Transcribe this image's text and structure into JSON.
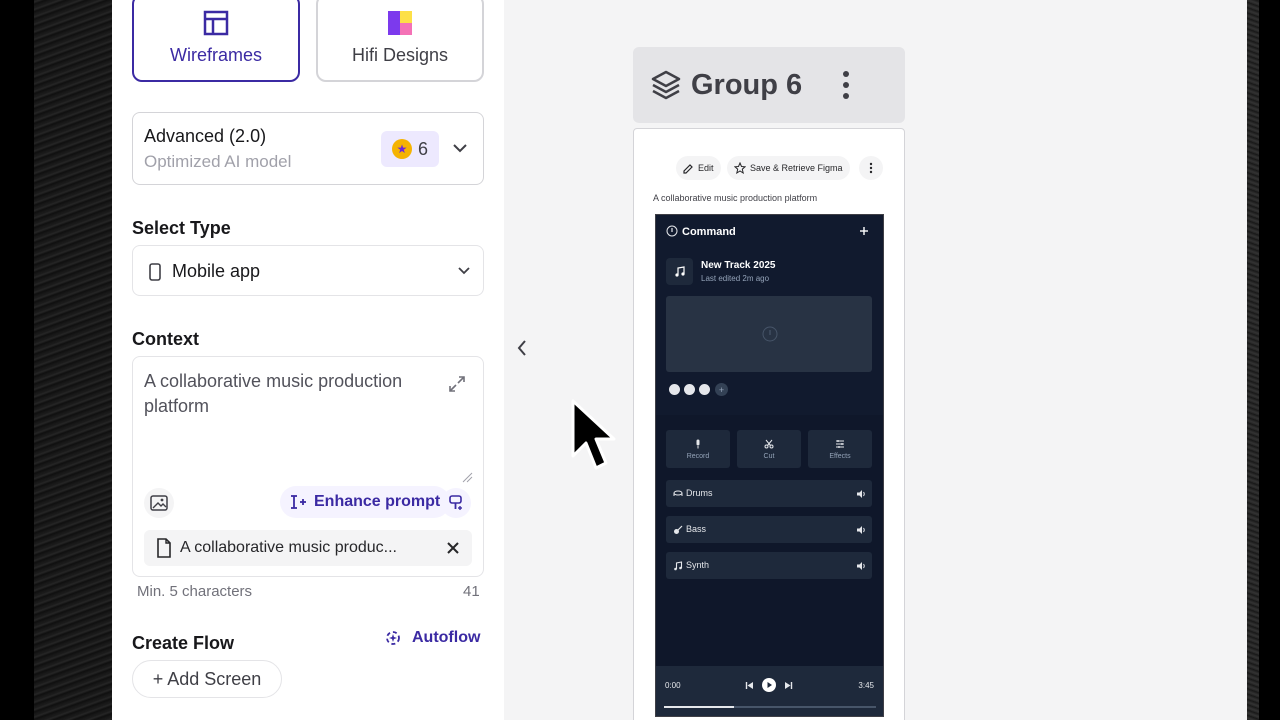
{
  "modes": [
    {
      "label": "Wireframes",
      "active": true,
      "icon": "layout-icon"
    },
    {
      "label": "Hifi Designs",
      "active": false,
      "icon": "palette-icon"
    }
  ],
  "model": {
    "title": "Advanced (2.0)",
    "subtitle": "Optimized AI model",
    "credits": "6"
  },
  "select_type": {
    "label": "Select Type",
    "value": "Mobile app"
  },
  "context": {
    "label": "Context",
    "text": "A collaborative music production platform",
    "enhance_label": "Enhance prompt",
    "attachment_name": "A collaborative music produc...",
    "min_hint": "Min. 5 characters",
    "char_count": "41"
  },
  "create_flow": {
    "label": "Create Flow",
    "autoflow_label": "Autoflow",
    "add_screen_label": "+ Add Screen"
  },
  "canvas": {
    "group_title": "Group 6",
    "toolbar": {
      "edit_label": "Edit",
      "save_label": "Save & Retrieve Figma"
    },
    "frame_description": "A collaborative music production platform",
    "phone": {
      "title": "Command",
      "track_name": "New Track 2025",
      "track_meta": "Last edited 2m ago",
      "tools": [
        "Record",
        "Cut",
        "Effects"
      ],
      "instruments": [
        "Drums",
        "Bass",
        "Synth"
      ],
      "time_start": "0:00",
      "time_end": "3:45",
      "progress": 0.33
    }
  },
  "colors": {
    "accent": "#3b2aa3",
    "phone_bg": "#0f172a"
  }
}
